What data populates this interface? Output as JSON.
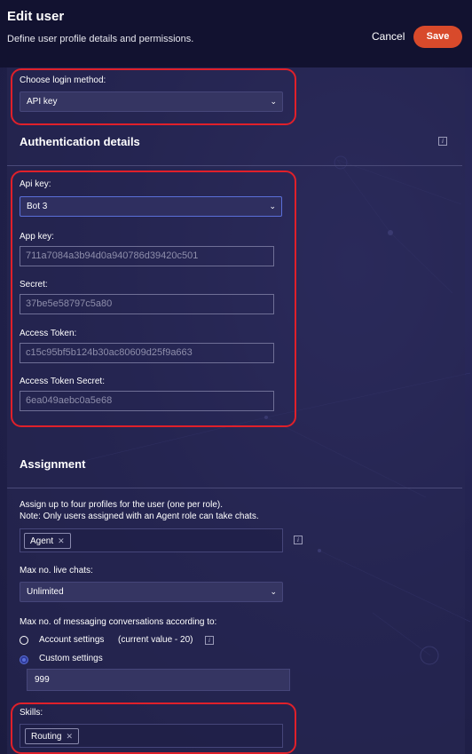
{
  "header": {
    "title": "Edit user",
    "subtitle": "Define user profile details and permissions.",
    "cancel_label": "Cancel",
    "save_label": "Save"
  },
  "login": {
    "label": "Choose login method:",
    "value": "API key"
  },
  "auth": {
    "title": "Authentication details",
    "api_key_label": "Api key:",
    "api_key_value": "Bot 3",
    "app_key_label": "App key:",
    "app_key_value": "711a7084a3b94d0a940786d39420c501",
    "secret_label": "Secret:",
    "secret_value": "37be5e58797c5a80",
    "access_token_label": "Access Token:",
    "access_token_value": "c15c95bf5b124b30ac80609d25f9a663",
    "access_token_secret_label": "Access Token Secret:",
    "access_token_secret_value": "6ea049aebc0a5e68"
  },
  "assignment": {
    "title": "Assignment",
    "note_line1": "Assign up to four profiles for the user (one per role).",
    "note_line2": "Note: Only users assigned with an Agent role can take chats.",
    "profile_tag": "Agent",
    "max_chats_label": "Max no. live chats:",
    "max_chats_value": "Unlimited",
    "max_conversations_label": "Max no. of messaging conversations according to:",
    "radio_account": "Account settings",
    "radio_account_hint": "(current value - 20)",
    "radio_custom": "Custom settings",
    "custom_value": "999",
    "skills_label": "Skills:",
    "skill_tag": "Routing"
  },
  "icons": {
    "info": "info-icon",
    "chevron": "chevron-down-icon",
    "remove": "close-icon"
  },
  "colors": {
    "accent": "#d84a2b",
    "highlight": "#e0202a",
    "focus": "#5a6fd8",
    "background": "#1c1c42"
  }
}
